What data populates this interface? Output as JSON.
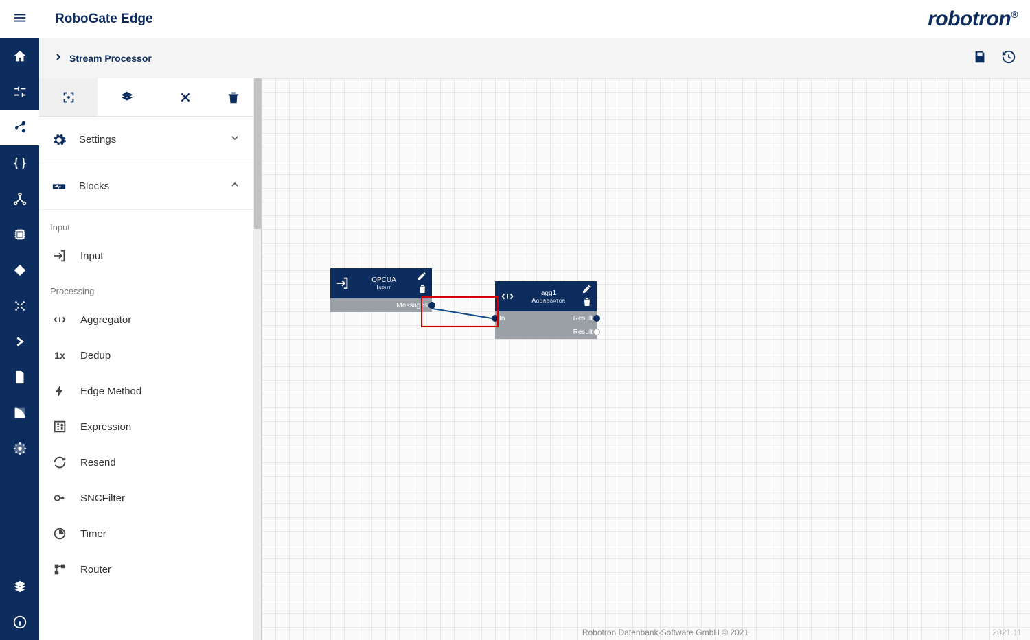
{
  "app_title": "RoboGate Edge",
  "brand": "robotron",
  "breadcrumb": {
    "label": "Stream Processor"
  },
  "panel": {
    "settings_label": "Settings",
    "blocks_label": "Blocks",
    "group_input": "Input",
    "group_processing": "Processing",
    "items": {
      "input": "Input",
      "aggregator": "Aggregator",
      "dedup": "Dedup",
      "edge_method": "Edge Method",
      "expression": "Expression",
      "resend": "Resend",
      "sncfilter": "SNCFilter",
      "timer": "Timer",
      "router": "Router"
    }
  },
  "nodes": {
    "n1": {
      "name": "OPCUA",
      "type": "Input",
      "port_out": "Messages"
    },
    "n2": {
      "name": "agg1",
      "type": "Aggregator",
      "port_in": "In",
      "port_out1": "Result",
      "port_out2": "Result"
    }
  },
  "footer": {
    "copyright": "Robotron Datenbank-Software GmbH © 2021",
    "version": "2021.11"
  }
}
